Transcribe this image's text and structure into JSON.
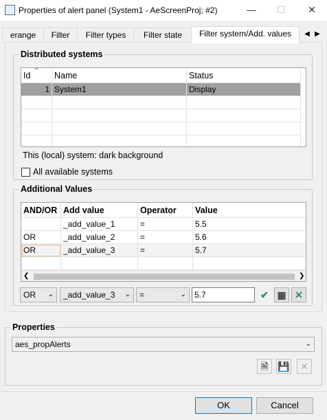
{
  "window": {
    "title": "Properties of alert panel (System1 - AeScreenProj; #2)"
  },
  "tabs": [
    {
      "label": "erange"
    },
    {
      "label": "Filter"
    },
    {
      "label": "Filter types"
    },
    {
      "label": "Filter state"
    },
    {
      "label": "Filter system/Add. values"
    }
  ],
  "distributed": {
    "label": "Distributed systems",
    "columns": [
      "Id",
      "Name",
      "Status"
    ],
    "rows": [
      {
        "id": "1",
        "name": "System1",
        "status": "Display"
      }
    ],
    "local_note": "This (local) system: dark background",
    "all_systems_label": "All available systems"
  },
  "additional": {
    "label": "Additional Values",
    "columns": [
      "AND/OR",
      "Add value",
      "Operator",
      "Value"
    ],
    "rows": [
      {
        "andor": "",
        "add": "_add_value_1",
        "op": "=",
        "val": "5.5"
      },
      {
        "andor": "OR",
        "add": "_add_value_2",
        "op": "=",
        "val": "5.6"
      },
      {
        "andor": "OR",
        "add": "_add_value_3",
        "op": "=",
        "val": "5.7"
      }
    ],
    "editor": {
      "andor": "OR",
      "add": "_add_value_3",
      "op": "=",
      "val": "5.7"
    }
  },
  "properties": {
    "label": "Properties",
    "selected": "aes_propAlerts"
  },
  "buttons": {
    "ok": "OK",
    "cancel": "Cancel"
  },
  "colors": {
    "selection": "#a0a0a0",
    "accent": "#0078d7",
    "confirm": "#2e8b57"
  }
}
